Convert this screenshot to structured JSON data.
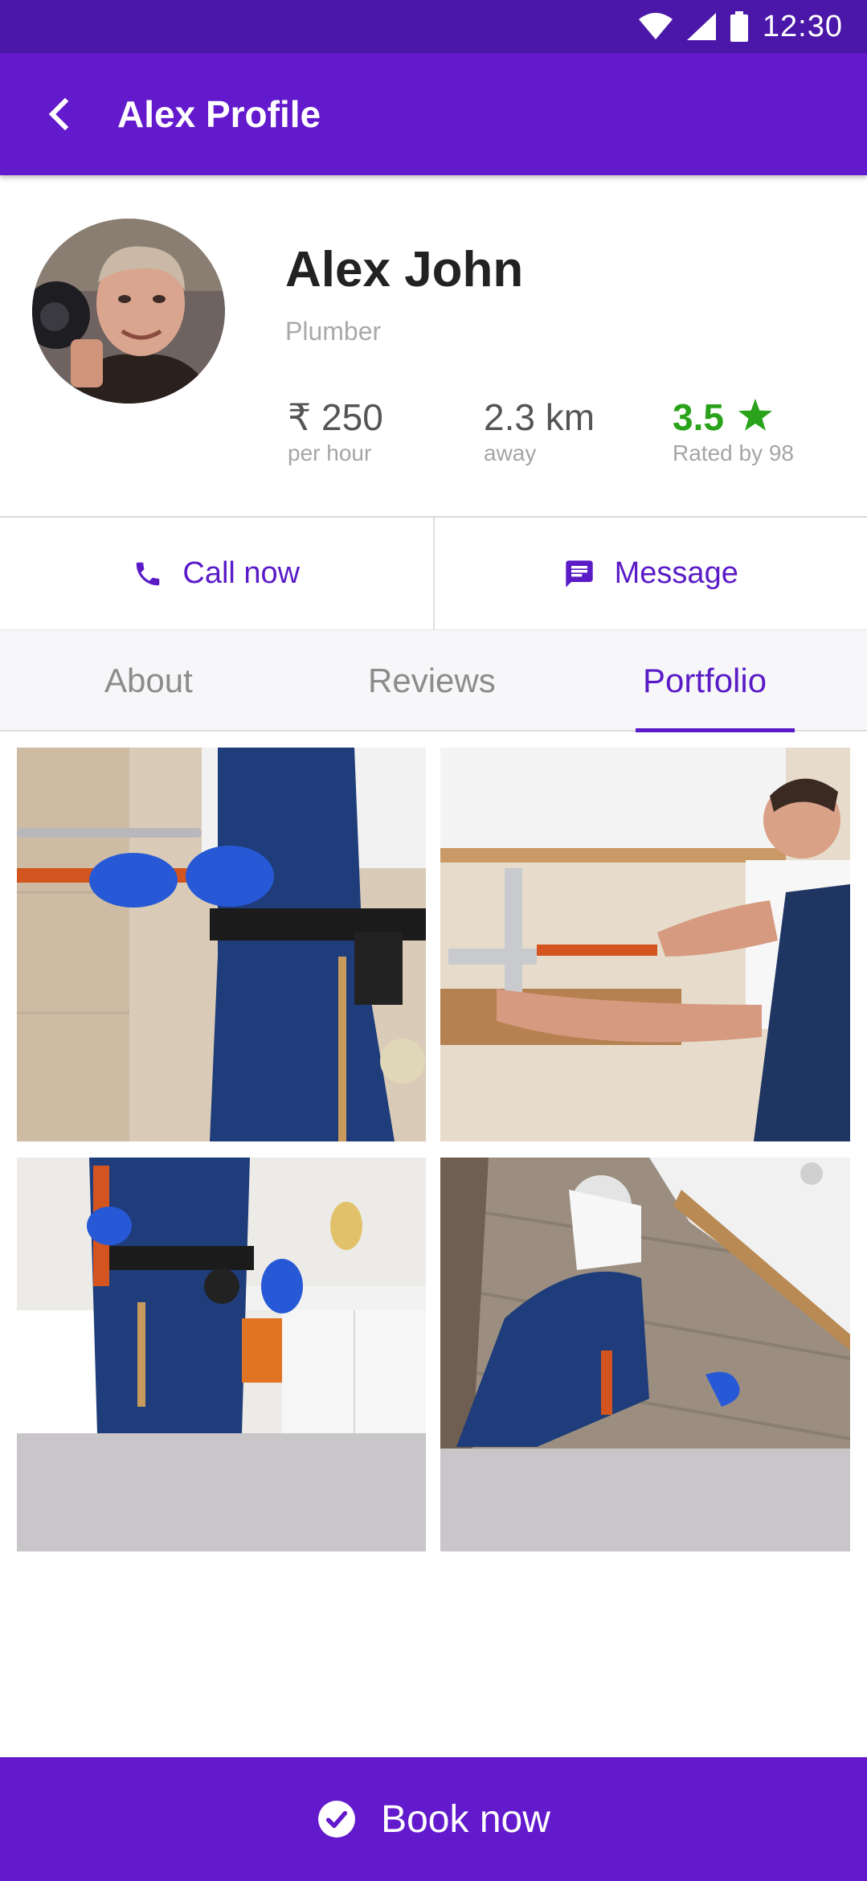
{
  "status_bar": {
    "time": "12:30",
    "icons": [
      "wifi-icon",
      "signal-icon",
      "battery-icon"
    ]
  },
  "app_bar": {
    "title": "Alex Profile",
    "back_icon": "chevron-left-icon"
  },
  "profile": {
    "name": "Alex John",
    "trade": "Plumber",
    "rate": {
      "value": "₹ 250",
      "label": "per hour"
    },
    "distance": {
      "value": "2.3 km",
      "label": "away"
    },
    "rating": {
      "value": "3.5",
      "label": "Rated by 98",
      "icon": "star-icon"
    }
  },
  "actions": {
    "call": {
      "label": "Call now",
      "icon": "phone-icon"
    },
    "message": {
      "label": "Message",
      "icon": "chat-icon"
    }
  },
  "tabs": {
    "items": [
      {
        "label": "About"
      },
      {
        "label": "Reviews"
      },
      {
        "label": "Portfolio"
      }
    ],
    "active": "Portfolio"
  },
  "book": {
    "label": "Book now",
    "icon": "check-circle-icon"
  },
  "colors": {
    "primary": "#6319cc",
    "status_bar": "#4a17a8",
    "accent": "#5a1bc7",
    "rating_green": "#2aa31a"
  }
}
